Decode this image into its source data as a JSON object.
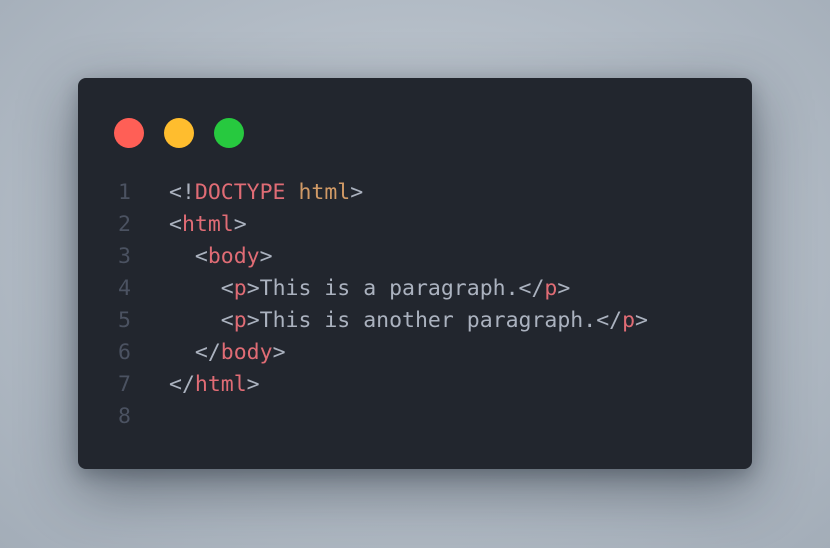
{
  "colors": {
    "background": "#b3bcc6",
    "editor_bg": "#22262e",
    "line_number": "#4b5261",
    "punctuation": "#abb2bf",
    "tag": "#e06c75",
    "attribute": "#d19a66",
    "text": "#abb2bf"
  },
  "window_controls": [
    {
      "name": "close",
      "color": "#ff5f56"
    },
    {
      "name": "minimize",
      "color": "#ffbd2e"
    },
    {
      "name": "maximize",
      "color": "#27c93f"
    }
  ],
  "code": {
    "lines": [
      {
        "number": "1",
        "tokens": [
          {
            "type": "p",
            "text": "<!"
          },
          {
            "type": "k",
            "text": "DOCTYPE"
          },
          {
            "type": "p",
            "text": " "
          },
          {
            "type": "a",
            "text": "html"
          },
          {
            "type": "p",
            "text": ">"
          }
        ]
      },
      {
        "number": "2",
        "tokens": [
          {
            "type": "p",
            "text": "<"
          },
          {
            "type": "t",
            "text": "html"
          },
          {
            "type": "p",
            "text": ">"
          }
        ]
      },
      {
        "number": "3",
        "tokens": [
          {
            "type": "p",
            "text": "  <"
          },
          {
            "type": "t",
            "text": "body"
          },
          {
            "type": "p",
            "text": ">"
          }
        ]
      },
      {
        "number": "4",
        "tokens": [
          {
            "type": "p",
            "text": "    <"
          },
          {
            "type": "t",
            "text": "p"
          },
          {
            "type": "p",
            "text": ">"
          },
          {
            "type": "x",
            "text": "This is a paragraph."
          },
          {
            "type": "p",
            "text": "</"
          },
          {
            "type": "t",
            "text": "p"
          },
          {
            "type": "p",
            "text": ">"
          }
        ]
      },
      {
        "number": "5",
        "tokens": [
          {
            "type": "p",
            "text": "    <"
          },
          {
            "type": "t",
            "text": "p"
          },
          {
            "type": "p",
            "text": ">"
          },
          {
            "type": "x",
            "text": "This is another paragraph."
          },
          {
            "type": "p",
            "text": "</"
          },
          {
            "type": "t",
            "text": "p"
          },
          {
            "type": "p",
            "text": ">"
          }
        ]
      },
      {
        "number": "6",
        "tokens": [
          {
            "type": "p",
            "text": "  </"
          },
          {
            "type": "t",
            "text": "body"
          },
          {
            "type": "p",
            "text": ">"
          }
        ]
      },
      {
        "number": "7",
        "tokens": [
          {
            "type": "p",
            "text": "</"
          },
          {
            "type": "t",
            "text": "html"
          },
          {
            "type": "p",
            "text": ">"
          }
        ]
      },
      {
        "number": "8",
        "tokens": []
      }
    ]
  }
}
